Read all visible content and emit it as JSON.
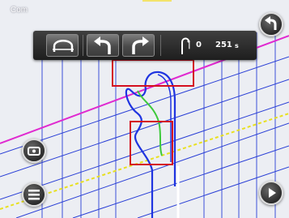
{
  "app": {
    "title": "Com"
  },
  "toolbar": {
    "buttons": [
      {
        "name": "stitch-icon"
      },
      {
        "name": "undo-arrow-icon"
      },
      {
        "name": "redo-arrow-icon"
      }
    ],
    "counter": {
      "value_a": "0",
      "value_b": "251",
      "suffix": "s"
    }
  },
  "side_buttons": {
    "top_right": "back-arrow-icon",
    "left_upper": "needle-icon",
    "left_lower": "menu-icon",
    "bottom_right": "play-icon"
  },
  "colors": {
    "grid_blue": "#2a3fd6",
    "diagonal_magenta": "#e02ad0",
    "highlight_red": "#d40f1f",
    "stitch_green": "#3dc93a",
    "yellow_dashed": "#e8e020"
  }
}
